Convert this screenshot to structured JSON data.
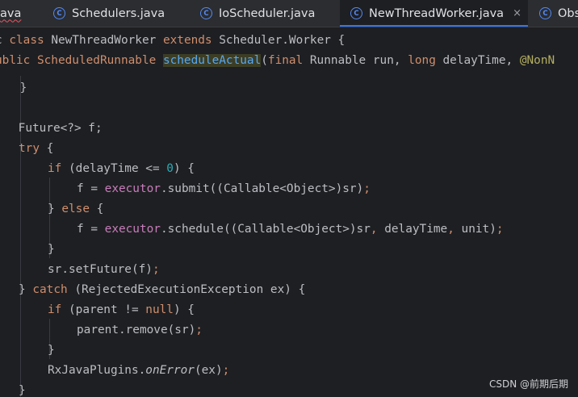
{
  "tabs": [
    {
      "label": "ava",
      "icon": "",
      "active": false
    },
    {
      "label": "Schedulers.java",
      "icon": "C",
      "active": false
    },
    {
      "label": "IoScheduler.java",
      "icon": "C",
      "active": false
    },
    {
      "label": "NewThreadWorker.java",
      "icon": "C",
      "active": true,
      "close": "×"
    },
    {
      "label": "Obs",
      "icon": "C",
      "active": false
    }
  ],
  "code": {
    "header1": {
      "p1": "c ",
      "k1": "class",
      "p2": " NewThreadWorker ",
      "k2": "extends",
      "p3": " Scheduler.Worker {"
    },
    "header2": {
      "p1": "ublic ScheduledRunnable ",
      "method": "scheduleActual",
      "p2": "(",
      "k1": "final",
      "p3": " Runnable run, ",
      "k2": "long",
      "p4": " delayTime, ",
      "ann": "@NonN"
    },
    "l1": "    }",
    "l2": {
      "type": "    Future<?> f;"
    },
    "l3": {
      "kw": "try",
      "rest": " {"
    },
    "l4": {
      "kw": "if",
      "p1": " (delayTime <= ",
      "num": "0",
      "p2": ") {"
    },
    "l5": {
      "p1": "f = ",
      "fld": "executor",
      "p2": ".submit((Callable<Object>)sr)",
      "semi": ";"
    },
    "l6": {
      "p1": "} ",
      "kw": "else",
      "p2": " {"
    },
    "l7": {
      "p1": "f = ",
      "fld": "executor",
      "p2": ".schedule((Callable<Object>)sr",
      "c1": ",",
      "p3": " delayTime",
      "c2": ",",
      "p4": " unit)",
      "semi": ";"
    },
    "l8": "}",
    "l9": {
      "p1": "sr.setFuture(f)",
      "semi": ";"
    },
    "l10": {
      "p1": "} ",
      "kw": "catch",
      "p2": " (RejectedExecutionException ex) {"
    },
    "l11": {
      "kw1": "if",
      "p1": " (parent != ",
      "kw2": "null",
      "p2": ") {"
    },
    "l12": {
      "p1": "parent.remove(sr)",
      "semi": ";"
    },
    "l13": "}",
    "l14": {
      "p1": "RxJavaPlugins.",
      "fn": "onError",
      "p2": "(ex)",
      "semi": ";"
    },
    "l15": "}"
  },
  "watermark": "CSDN @前期后期"
}
